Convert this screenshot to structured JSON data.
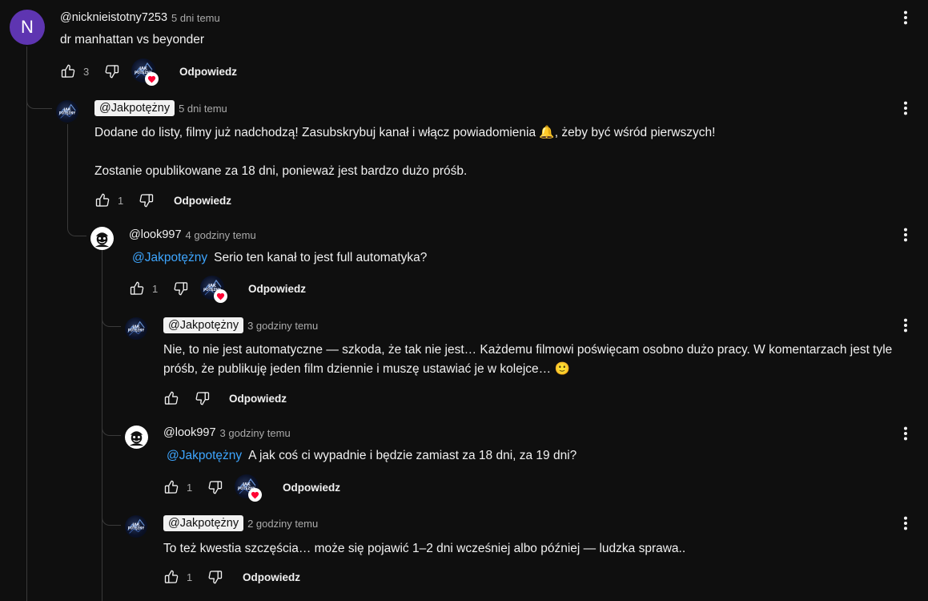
{
  "comments": [
    {
      "author": "@nicknieistotny7253",
      "time": "5 dni temu",
      "avatar_letter": "N",
      "text": "dr manhattan vs beyonder",
      "likes": "3",
      "reply": "Odpowiedz"
    },
    {
      "author": "@Jakpotężny",
      "time": "5 dni temu",
      "text1": "Dodane do listy, filmy już nadchodzą! Zasubskrybuj kanał i włącz powiadomienia 🔔, żeby być wśród pierwszych!",
      "text2": "Zostanie opublikowane za 18 dni, ponieważ jest bardzo dużo próśb.",
      "likes": "1",
      "reply": "Odpowiedz"
    },
    {
      "author": "@look997",
      "time": "4 godziny temu",
      "mention": "@Jakpotężny",
      "text": "Serio ten kanał to jest full automatyka?",
      "likes": "1",
      "reply": "Odpowiedz"
    },
    {
      "author": "@Jakpotężny",
      "time": "3 godziny temu",
      "text": "Nie, to nie jest automatyczne — szkoda, że tak nie jest… Każdemu filmowi poświęcam osobno dużo pracy. W komentarzach jest tyle próśb, że publikuję jeden film dziennie i muszę ustawiać je w kolejce… 🙂",
      "likes": "",
      "reply": "Odpowiedz"
    },
    {
      "author": "@look997",
      "time": "3 godziny temu",
      "mention": "@Jakpotężny",
      "text": "A jak coś ci wypadnie i będzie zamiast za 18 dni, za 19 dni?",
      "likes": "1",
      "reply": "Odpowiedz"
    },
    {
      "author": "@Jakpotężny",
      "time": "2 godziny temu",
      "text": "To też kwestia szczęścia… może się pojawić 1–2 dni wcześniej albo później — ludzka sprawa..",
      "likes": "1",
      "reply": "Odpowiedz"
    }
  ],
  "icons": {
    "like": "thumbs-up-icon",
    "dislike": "thumbs-down-icon",
    "menu": "more-vert-icon",
    "heart": "creator-heart-icon"
  },
  "colors": {
    "background": "#0f0f0f",
    "mention": "#3ea6ff",
    "heart": "#ff0033",
    "avatar_n": "#5e35b1"
  }
}
